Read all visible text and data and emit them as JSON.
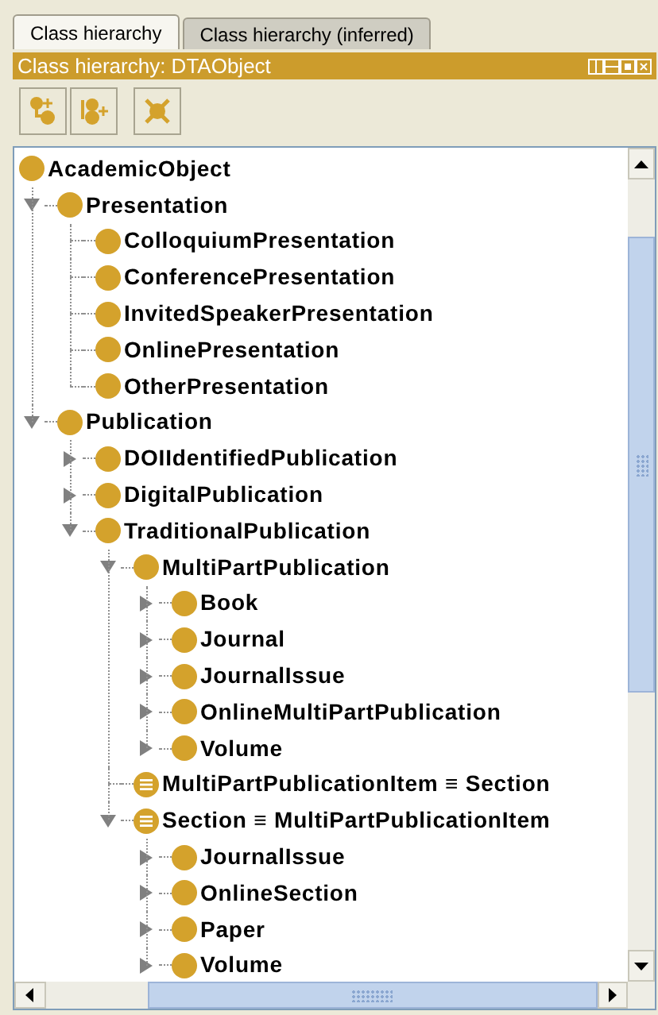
{
  "tabs": [
    {
      "label": "Class hierarchy",
      "selected": true
    },
    {
      "label": "Class hierarchy (inferred)",
      "selected": false
    }
  ],
  "panel": {
    "title": "Class hierarchy: DTAObject"
  },
  "tree": [
    {
      "label": "AcademicObject",
      "kind": "primitive",
      "children": [
        {
          "label": "Presentation",
          "kind": "primitive",
          "expanded": true,
          "children": [
            {
              "label": "ColloquiumPresentation",
              "kind": "primitive"
            },
            {
              "label": "ConferencePresentation",
              "kind": "primitive"
            },
            {
              "label": "InvitedSpeakerPresentation",
              "kind": "primitive"
            },
            {
              "label": "OnlinePresentation",
              "kind": "primitive"
            },
            {
              "label": "OtherPresentation",
              "kind": "primitive"
            }
          ]
        },
        {
          "label": "Publication",
          "kind": "primitive",
          "expanded": true,
          "children": [
            {
              "label": "DOIIdentifiedPublication",
              "kind": "primitive",
              "expanded": false
            },
            {
              "label": "DigitalPublication",
              "kind": "primitive",
              "expanded": false
            },
            {
              "label": "TraditionalPublication",
              "kind": "primitive",
              "expanded": true,
              "children": [
                {
                  "label": "MultiPartPublication",
                  "kind": "primitive",
                  "expanded": true,
                  "children": [
                    {
                      "label": "Book",
                      "kind": "primitive",
                      "expanded": false
                    },
                    {
                      "label": "Journal",
                      "kind": "primitive",
                      "expanded": false
                    },
                    {
                      "label": "JournalIssue",
                      "kind": "primitive",
                      "expanded": false
                    },
                    {
                      "label": "OnlineMultiPartPublication",
                      "kind": "primitive",
                      "expanded": false
                    },
                    {
                      "label": "Volume",
                      "kind": "primitive",
                      "expanded": false
                    }
                  ]
                },
                {
                  "label": "MultiPartPublicationItem ≡ Section",
                  "kind": "defined"
                },
                {
                  "label": "Section ≡ MultiPartPublicationItem",
                  "kind": "defined",
                  "expanded": true,
                  "children": [
                    {
                      "label": "JournalIssue",
                      "kind": "primitive",
                      "expanded": false
                    },
                    {
                      "label": "OnlineSection",
                      "kind": "primitive",
                      "expanded": false
                    },
                    {
                      "label": "Paper",
                      "kind": "primitive",
                      "expanded": false
                    },
                    {
                      "label": "Volume",
                      "kind": "primitive",
                      "expanded": false
                    }
                  ]
                }
              ]
            }
          ]
        }
      ]
    }
  ]
}
